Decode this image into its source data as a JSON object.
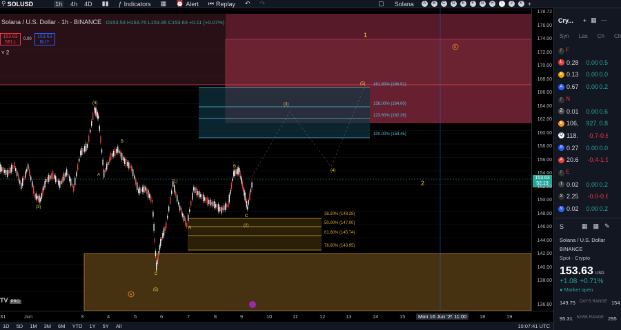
{
  "topbar": {
    "symbol": "SOLUSD",
    "timeframes": [
      "1h",
      "4h",
      "4D"
    ],
    "indicators": "Indicators",
    "alert": "Alert",
    "replay": "Replay",
    "watch_symbol": "Solana",
    "letters": [
      "A",
      "B",
      "C",
      "D",
      "E",
      "F",
      "G",
      "H",
      "I",
      "J",
      "K"
    ]
  },
  "legend": {
    "name": "Solana / U.S. Dollar · 1h · BINANCE",
    "ohlc": "O153.53 H153.75 L153.35 C153.63 +0.11 (+0.07%)",
    "sell_price": "153.63",
    "sell": "SELL",
    "spread": "0.00",
    "buy_price": "153.63",
    "buy": "BUY",
    "layers": "2"
  },
  "price_ticks": [
    "178.72",
    "176.00",
    "174.00",
    "172.00",
    "170.00",
    "168.00",
    "166.00",
    "164.00",
    "162.00",
    "160.00",
    "158.00",
    "156.00",
    "154.00",
    "152.00",
    "150.00",
    "148.00",
    "146.00",
    "144.00",
    "142.00",
    "140.00",
    "138.00",
    "136.80"
  ],
  "current_price": "153.63",
  "countdown": "52:19",
  "time_ticks": [
    "31",
    "Jun",
    "3",
    "4",
    "5",
    "6",
    "7",
    "8",
    "9",
    "10",
    "11",
    "12",
    "13",
    "14",
    "15",
    "Mon 16 Jun '25",
    "11:00",
    "18",
    "19"
  ],
  "fib_upper": [
    "161.80% (166.91)",
    "138.00% (164.00)",
    "123.60% (162.26)",
    "100.00% (159.45)"
  ],
  "fib_lower": [
    "38.20% (148.28)",
    "50.00% (147.00)",
    "61.80% (145.74)",
    "78.60% (143.95)"
  ],
  "wave_labels": {
    "w1": "1",
    "w2": "2",
    "w3": "(3)",
    "w4": "(4)",
    "w5": "(5)",
    "wB": "B",
    "wA": "A",
    "wC": "C",
    "l3": "(3)",
    "l4": "(4)",
    "l1": "(1)",
    "l2": "(2)",
    "l5": "(5)",
    "circA": "A",
    "circB": "B"
  },
  "bottombar": {
    "ranges": [
      "1D",
      "5D",
      "1M",
      "3M",
      "6M",
      "YTD",
      "1Y",
      "5Y",
      "All"
    ],
    "clock": "10:07:41 UTC"
  },
  "panel": {
    "title": "Cry...",
    "cols": [
      "Syn",
      "Las",
      "Ch",
      "Ch"
    ],
    "rows": [
      {
        "flag": "F"
      },
      {
        "ic": "L",
        "nm": "0.",
        "pr": "0.28",
        "ch": "0.00",
        "chp": "0.5",
        "color": "#e8433a",
        "dir": "green"
      },
      {
        "ic": "B",
        "nm": "0.",
        "pr": "0.13",
        "ch": "0.00",
        "chp": "0.0",
        "color": "#f0a500",
        "dir": "green"
      },
      {
        "ic": "A",
        "nm": "0.",
        "pr": "0.67",
        "ch": "0.00",
        "chp": "0.2",
        "color": "#2962ff",
        "dir": "green"
      },
      {
        "flag": "N"
      },
      {
        "ic": "Z",
        "nm": "0.",
        "pr": "0.01",
        "ch": "0.00",
        "chp": "0.6",
        "color": "#555",
        "dir": "green"
      },
      {
        "ic": "B",
        "nm": "1",
        "pr": "106,",
        "ch": "927.",
        "chp": "0.8",
        "color": "#f7931a",
        "dir": "green"
      },
      {
        "ic": "Q",
        "nm": "1",
        "pr": "118.",
        "ch": "-0.7",
        "chp": "-0.6",
        "color": "#fff",
        "dir": "red"
      },
      {
        "ic": "S",
        "nm": "0.",
        "pr": "0.27",
        "ch": "0.00",
        "chp": "0.0",
        "color": "#2962ff",
        "dir": "green"
      },
      {
        "ic": "A",
        "nm": "2",
        "pr": "20.6",
        "ch": "-0.4",
        "chp": "-1.9",
        "color": "#e8433a",
        "dir": "red"
      },
      {
        "flag": "E"
      },
      {
        "ic": "I",
        "nm": "0.",
        "pr": "0.02",
        "ch": "0.00",
        "chp": "0.2",
        "color": "#444",
        "dir": "green"
      },
      {
        "ic": "X",
        "nm": "2.",
        "pr": "2.25",
        "ch": "-0.0",
        "chp": "-0.6",
        "color": "#333",
        "dir": "red"
      },
      {
        "ic": "V",
        "nm": "0.",
        "pr": "0.02",
        "ch": "0.00",
        "chp": "0.2",
        "color": "#2962ff",
        "dir": "green"
      }
    ],
    "detail": {
      "short": "S",
      "name": "Solana / U.S. Dollar",
      "exchange": "BINANCE",
      "type": "Spot · Crypto",
      "price": "153.63",
      "currency": "USD",
      "change": "+1.08",
      "change_pct": "+0.71%",
      "status": "Market open",
      "day_low": "149.75",
      "day_range": "DAY'S RANGE",
      "day_high": "154",
      "week_low": "95.31",
      "week_range": "52WK RANGE",
      "week_high": "295"
    }
  }
}
